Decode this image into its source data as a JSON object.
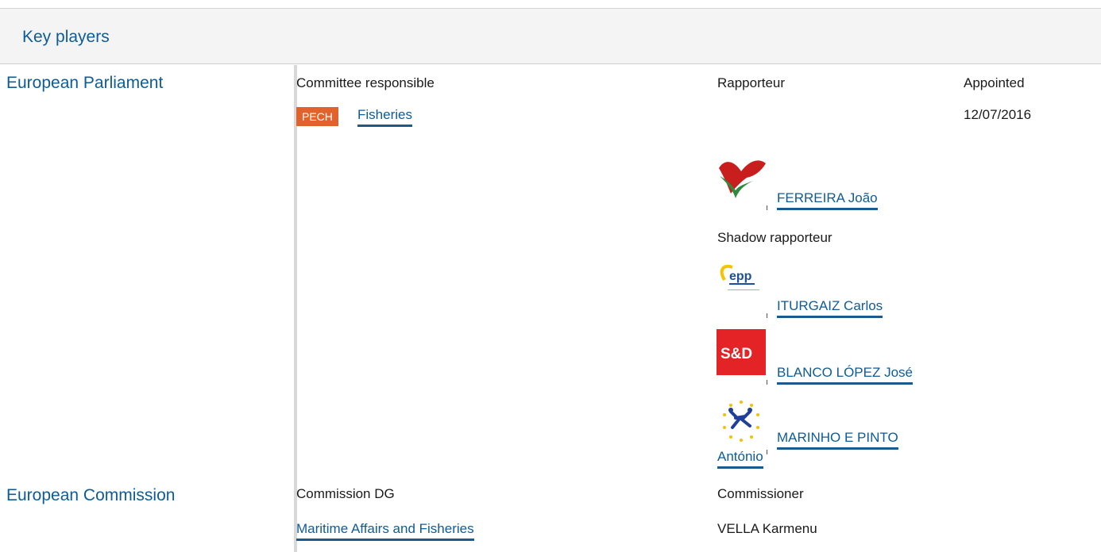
{
  "panel": {
    "title": "Key players"
  },
  "parliament": {
    "institution": "European Parliament",
    "committee_header": "Committee responsible",
    "rapporteur_header": "Rapporteur",
    "appointed_header": "Appointed",
    "committee_code": "PECH",
    "committee_name": "Fisheries",
    "appointed_date": "12/07/2016",
    "rapporteur": {
      "name": "FERREIRA João",
      "group_logo": "gue-ngl-flag-logo"
    },
    "shadow_header": "Shadow rapporteur",
    "shadows": [
      {
        "name": "ITURGAIZ Carlos",
        "group_logo": "epp-logo"
      },
      {
        "name": "BLANCO LÓPEZ José",
        "group_logo": "sd-logo",
        "logo_text": "S&D"
      },
      {
        "name_line1": "MARINHO E PINTO",
        "name_line2": "António",
        "group_logo": "alde-stars-logo"
      }
    ]
  },
  "commission": {
    "institution": "European Commission",
    "dg_header": "Commission DG",
    "commissioner_header": "Commissioner",
    "dg_name": "Maritime Affairs and Fisheries",
    "commissioner_name": "VELLA Karmenu"
  },
  "colors": {
    "link": "#0e5c97",
    "badge": "#e2622b",
    "sd_red": "#e32326"
  }
}
